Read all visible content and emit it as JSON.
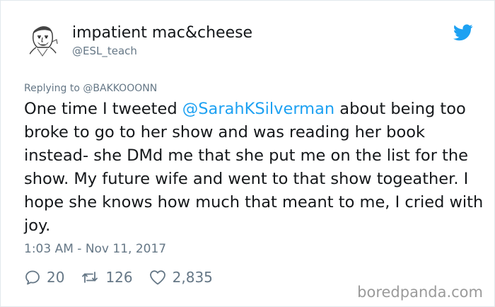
{
  "user": {
    "display_name": "impatient mac&cheese",
    "handle": "@ESL_teach",
    "avatar_icon": "sketch-portrait-avatar"
  },
  "header": {
    "brand_icon": "twitter-bird-icon",
    "brand_color": "#1da1f2"
  },
  "reply": {
    "prefix": "Replying to",
    "user": "@BAKKOOONN"
  },
  "tweet": {
    "text_before": "One time I tweeted ",
    "mention": "@SarahKSilverman",
    "text_after": " about being too broke to go to her show and was reading her book instead- she DMd me that she put me on the list for the show. My future wife and went to that show togeather. I hope she knows how much that meant to me, I cried with joy.",
    "timestamp": "1:03 AM - Nov 11, 2017"
  },
  "actions": {
    "replies": "20",
    "retweets": "126",
    "likes": "2,835"
  },
  "watermark": "boredpanda.com",
  "colors": {
    "text": "#14171a",
    "secondary": "#657786",
    "accent": "#1da1f2",
    "border": "#e1e8ed"
  }
}
